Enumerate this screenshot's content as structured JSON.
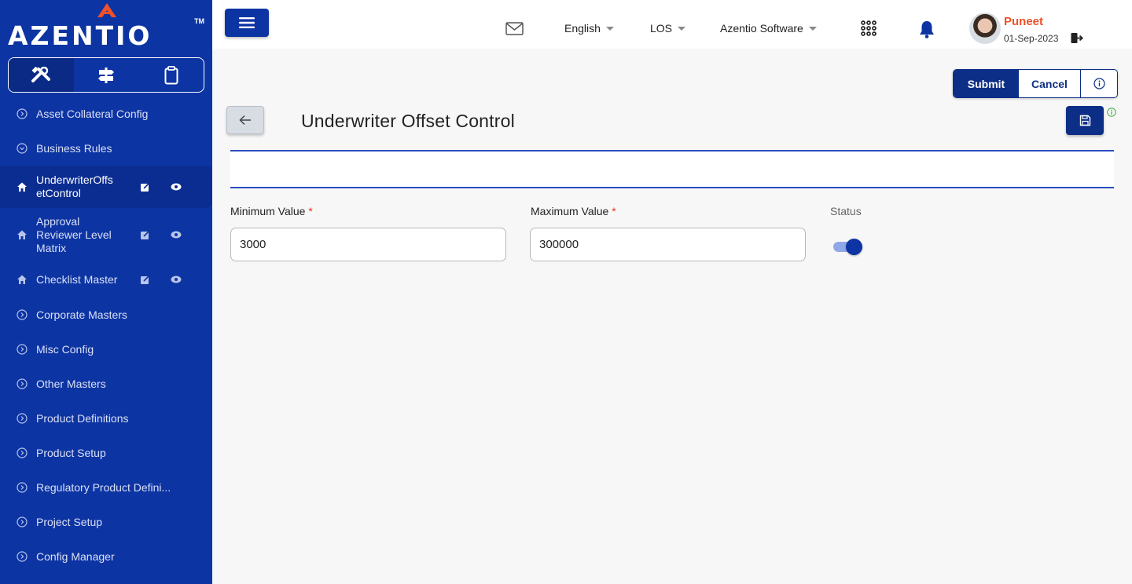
{
  "brand": {
    "name": "AZENTIO",
    "tm": "TM"
  },
  "sidebar": {
    "mode_tabs": [
      {
        "icon": "tools-icon",
        "active": true
      },
      {
        "icon": "signpost-icon",
        "active": false
      },
      {
        "icon": "clipboard-icon",
        "active": false
      }
    ],
    "items": [
      {
        "label": "Asset Collateral Config",
        "icon": "chevron-circle-icon"
      },
      {
        "label": "Business Rules",
        "icon": "chevron-circle-icon"
      },
      {
        "label": "UnderwriterOffsetControl",
        "icon": "home-icon",
        "active": true
      },
      {
        "label": "Approval Reviewer Level Matrix",
        "icon": "home-icon"
      },
      {
        "label": "Checklist Master",
        "icon": "home-icon"
      },
      {
        "label": "Corporate Masters",
        "icon": "chevron-circle-icon"
      },
      {
        "label": "Misc Config",
        "icon": "chevron-circle-icon"
      },
      {
        "label": "Other Masters",
        "icon": "chevron-circle-icon"
      },
      {
        "label": "Product Definitions",
        "icon": "chevron-circle-icon"
      },
      {
        "label": "Product Setup",
        "icon": "chevron-circle-icon"
      },
      {
        "label": "Regulatory Product Defini...",
        "icon": "chevron-circle-icon"
      },
      {
        "label": "Project Setup",
        "icon": "chevron-circle-icon"
      },
      {
        "label": "Config Manager",
        "icon": "chevron-circle-icon"
      }
    ]
  },
  "header": {
    "language": "English",
    "module": "LOS",
    "entity": "Azentio Software",
    "user": {
      "name": "Puneet",
      "date": "01-Sep-2023"
    }
  },
  "toolbar": {
    "submit_label": "Submit",
    "cancel_label": "Cancel"
  },
  "page": {
    "title": "Underwriter Offset Control",
    "form": {
      "min_label": "Minimum Value",
      "min_value": "3000",
      "max_label": "Maximum Value",
      "max_value": "300000",
      "required_mark": "*",
      "status_label": "Status",
      "status_on": true
    }
  },
  "colors": {
    "sidebar": "#0d34a3",
    "accent": "#0d2e86",
    "username": "#f0502a"
  }
}
